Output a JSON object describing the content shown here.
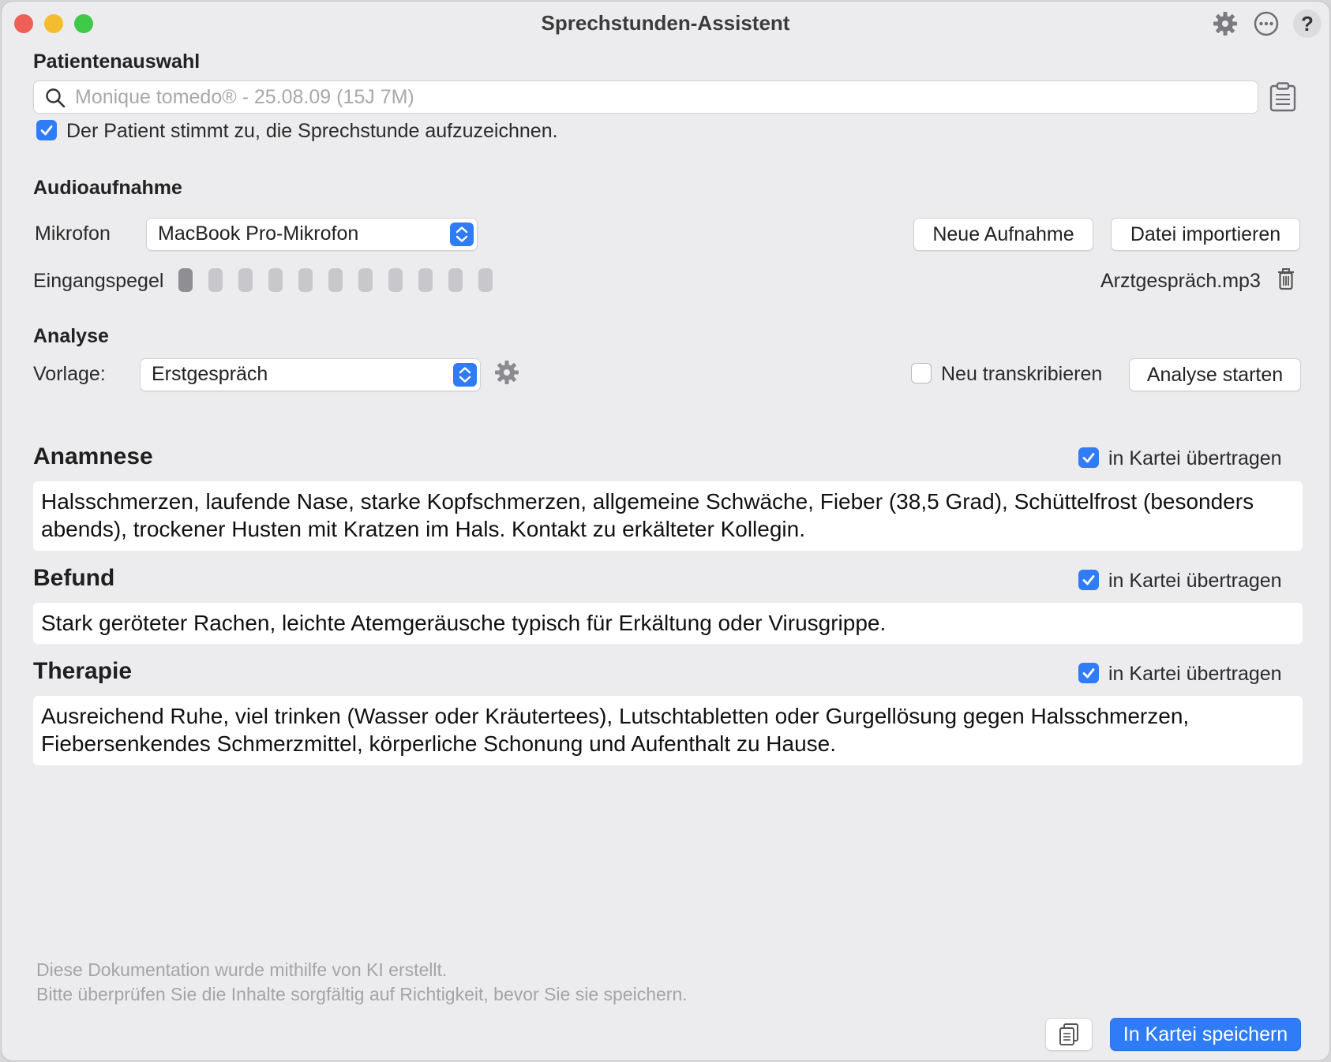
{
  "window": {
    "title": "Sprechstunden-Assistent",
    "help_label": "?"
  },
  "patient": {
    "section_title": "Patientenauswahl",
    "search_placeholder": "Monique tomedo® - 25.08.09 (15J 7M)",
    "consent_label": "Der Patient stimmt zu, die Sprechstunde aufzuzeichnen.",
    "consent_checked": true
  },
  "audio": {
    "section_title": "Audioaufnahme",
    "mic_label": "Mikrofon",
    "mic_value": "MacBook Pro-Mikrofon",
    "new_recording": "Neue Aufnahme",
    "import_file": "Datei importieren",
    "level_label": "Eingangspegel",
    "level_segments_total": 11,
    "level_segments_active": 1,
    "file_name": "Arztgespräch.mp3"
  },
  "analysis": {
    "section_title": "Analyse",
    "template_label": "Vorlage:",
    "template_value": "Erstgespräch",
    "retranscribe_label": "Neu transkribieren",
    "retranscribe_checked": false,
    "start_button": "Analyse starten"
  },
  "sections": [
    {
      "title": "Anamnese",
      "transfer_label": "in Kartei übertragen",
      "transfer_checked": true,
      "text": "Halsschmerzen, laufende Nase, starke Kopfschmerzen, allgemeine Schwäche, Fieber (38,5 Grad), Schüttelfrost (besonders abends), trockener Husten mit Kratzen im Hals. Kontakt zu erkälteter Kollegin."
    },
    {
      "title": "Befund",
      "transfer_label": "in Kartei übertragen",
      "transfer_checked": true,
      "text": "Stark geröteter Rachen, leichte Atemgeräusche typisch für Erkältung oder Virusgrippe."
    },
    {
      "title": "Therapie",
      "transfer_label": "in Kartei übertragen",
      "transfer_checked": true,
      "text": "Ausreichend Ruhe, viel trinken (Wasser oder Kräutertees), Lutschtabletten oder Gurgellösung gegen Halsschmerzen, Fiebersenkendes Schmerzmittel, körperliche Schonung und Aufenthalt zu Hause."
    }
  ],
  "footer": {
    "disclaimer_line1": "Diese Dokumentation wurde mithilfe von KI erstellt.",
    "disclaimer_line2": "Bitte überprüfen Sie die Inhalte sorgfältig auf Richtigkeit, bevor Sie sie speichern.",
    "save_button": "In Kartei speichern"
  },
  "colors": {
    "accent": "#2f7cf6",
    "window_bg": "#ececee",
    "close": "#ee5f57",
    "minimize": "#f4bd30",
    "maximize": "#3ec949"
  }
}
